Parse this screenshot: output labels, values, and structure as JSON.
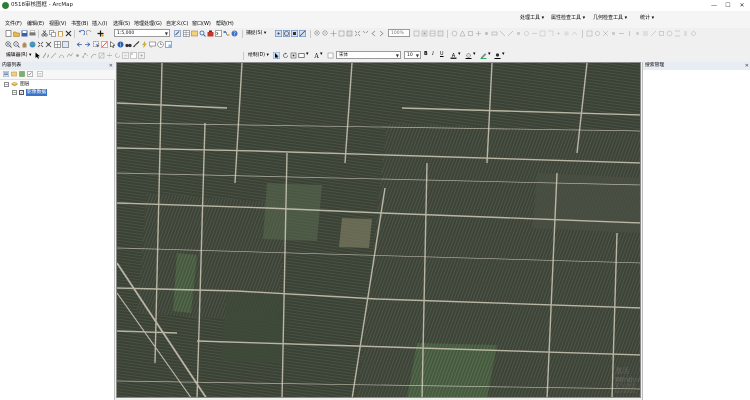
{
  "window": {
    "title": "0518审核图框 - ArcMap",
    "minimize": "—",
    "maximize": "☐",
    "close": "✕"
  },
  "menu": {
    "items": [
      "文件(F)",
      "编辑(E)",
      "视图(V)",
      "书签(B)",
      "插入(I)",
      "选择(S)",
      "地理处理(G)",
      "自定义(C)",
      "窗口(W)",
      "帮助(H)"
    ],
    "right_tools": [
      "处理工具 ▾",
      "属性检查工具 ▾",
      "几何检查工具 ▾",
      "统计 ▾"
    ]
  },
  "toolbar": {
    "scale_value": "1:5,000",
    "editor_label": "编辑器(R) ▾",
    "draw_label": "绘制(D) ▾",
    "snap_label": "捕捉(S) ▾",
    "font_value": "宋体",
    "font_size": "10",
    "zoom_pct": "100%"
  },
  "toc": {
    "title": "内容列表",
    "pin": "✕",
    "root_label": "图层",
    "layer_label": "影像数据",
    "expand_minus": "−",
    "check": "✓"
  },
  "catalog": {
    "title": "搜索管理",
    "pin": "✕"
  },
  "watermark": {
    "line1": "激活 Windows",
    "line2": "转到“设置”以激活 Windows。"
  },
  "colors": {
    "accent": "#3a74c9",
    "map_field_dark": "#3b4236",
    "map_road": "#cfc9b8"
  }
}
